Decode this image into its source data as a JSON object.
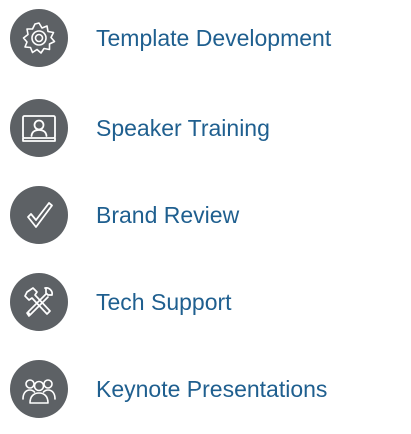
{
  "items": [
    {
      "label": "Template Development",
      "icon": "gear-icon"
    },
    {
      "label": "Speaker Training",
      "icon": "presenter-screen-icon"
    },
    {
      "label": "Brand Review",
      "icon": "checkmark-icon"
    },
    {
      "label": "Tech Support",
      "icon": "tools-icon"
    },
    {
      "label": "Keynote Presentations",
      "icon": "audience-group-icon"
    }
  ],
  "colors": {
    "icon_circle": "#5d6165",
    "icon_stroke": "#ffffff",
    "label_text": "#1f5f8f"
  }
}
